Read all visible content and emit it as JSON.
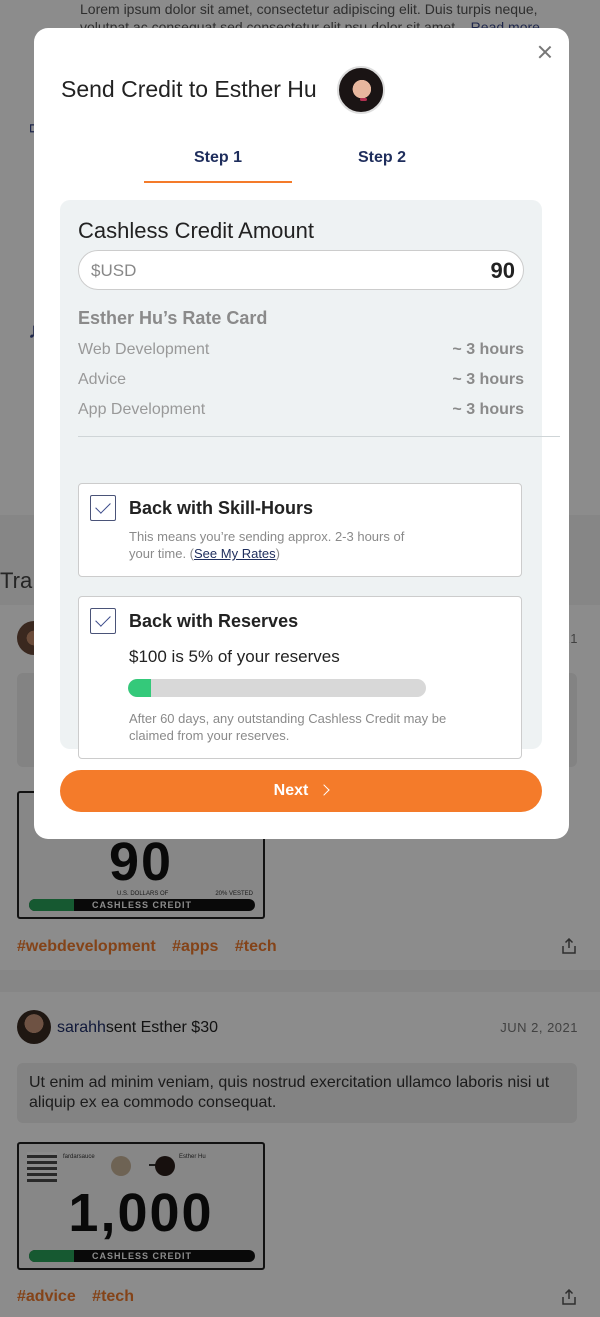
{
  "background": {
    "top_text_line1": "Lorem ipsum dolor sit amet, consectetur adipiscing elit. Duis turpis neque,",
    "top_text_line2": "volutpat ac consequat sed consectetur  elit psu dolor sit amet...",
    "read_more": "Read more",
    "section_title": "Tra",
    "post1": {
      "date_fragment": "21",
      "ticket_amount": "90",
      "ticket_caption_left": "U.S. DOLLARS OF",
      "ticket_caption_right": "20% VESTED",
      "ticket_label": "CASHLESS CREDIT",
      "tags": [
        "#webdevelopment",
        "#apps",
        "#tech"
      ]
    },
    "post2": {
      "user": "sarahh",
      "action": "sent Esther $30",
      "date": "JUN 2, 2021",
      "body": "Ut enim ad minim veniam, quis nostrud exercitation ullamco laboris nisi ut aliquip ex ea commodo consequat.",
      "ticket_sender": "fardarsauce",
      "ticket_recipient": "Esther Hu",
      "ticket_amount": "1,000",
      "ticket_label": "CASHLESS CREDIT",
      "tags": [
        "#advice",
        "#tech"
      ]
    }
  },
  "modal": {
    "title": "Send Credit to Esther Hu",
    "tabs": [
      {
        "label": "Step 1",
        "active": true
      },
      {
        "label": "Step 2",
        "active": false
      }
    ],
    "amount_section": {
      "title": "Cashless Credit Amount",
      "placeholder": "$USD",
      "value": "90"
    },
    "rate_card": {
      "title": "Esther Hu’s Rate Card",
      "rows": [
        {
          "name": "Web Development",
          "hours": "~ 3 hours"
        },
        {
          "name": "Advice",
          "hours": "~ 3 hours"
        },
        {
          "name": "App Development",
          "hours": "~ 3 hours"
        }
      ]
    },
    "skill_hours": {
      "checked": true,
      "title": "Back with Skill-Hours",
      "desc_line1": "This means you’re sending approx. 2-3 hours of",
      "desc_line2_prefix": "your time. (",
      "link": "See My Rates",
      "desc_line2_suffix": ")"
    },
    "reserves": {
      "checked": true,
      "title": "Back with Reserves",
      "summary": "$100 is 5% of your reserves",
      "percent": 5,
      "note": "After 60 days, any outstanding Cashless Credit may be claimed from your reserves."
    },
    "next_label": "Next"
  },
  "colors": {
    "accent_orange": "#f47b2a",
    "navy": "#1e2d5c",
    "progress_green": "#34c97a"
  }
}
